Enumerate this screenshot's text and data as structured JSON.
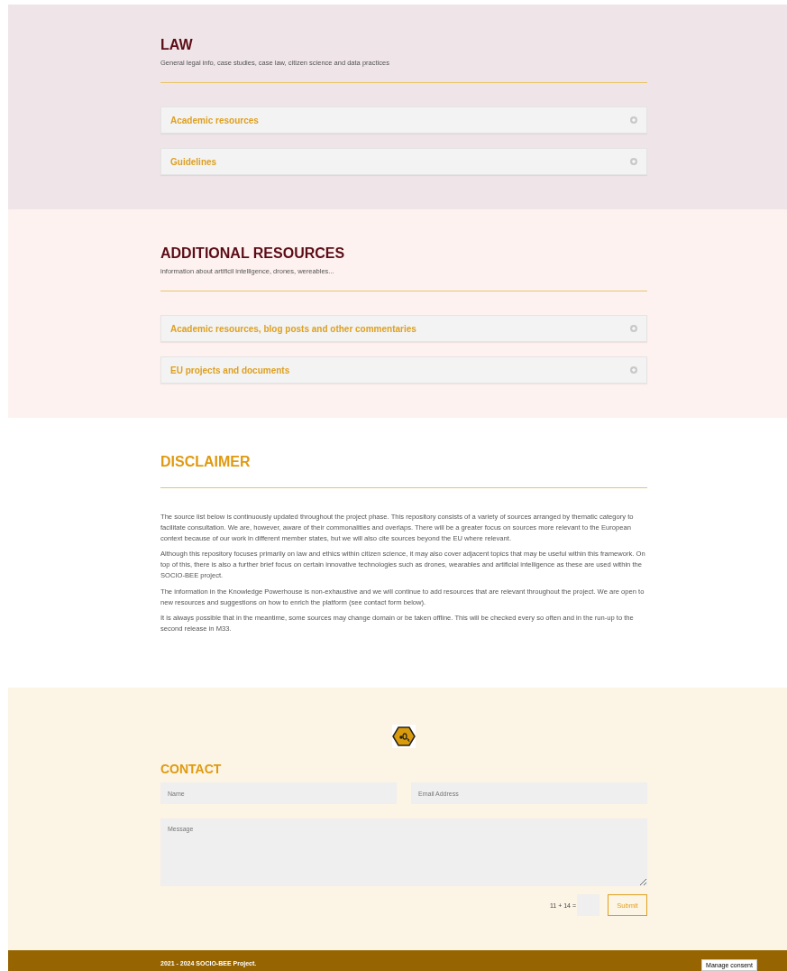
{
  "sections": [
    {
      "kind": "accordions",
      "color": "#efe5e8",
      "title": "LAW",
      "subtitle": "General legal info, case studies, case law, citizen science and data practices",
      "items": [
        {
          "label": "Academic resources",
          "expanded": false
        },
        {
          "label": "Guidelines",
          "expanded": false
        }
      ]
    },
    {
      "kind": "accordions",
      "color": "#fdf2ef",
      "title": "ADDITIONAL RESOURCES",
      "subtitle": "information about artificil intelligence, drones, wereables...",
      "items": [
        {
          "label": "Academic resources, blog posts and other commentaries",
          "expanded": false
        },
        {
          "label": "EU projects and documents",
          "expanded": false
        }
      ]
    },
    {
      "kind": "text",
      "color": "#ffffff",
      "title": "DISCLAIMER",
      "paragraphs": [
        "The source list below is continuously updated throughout the project phase. This repository consists of a variety of sources arranged by thematic category to facilitate consultation. We are, however, aware of their commonalities and overlaps. There will be a greater focus on sources more relevant to the European context because of our work in different member states, but we will also cite sources beyond the EU where relevant.",
        "Although this repository focuses primarily on law and ethics within citizen science, it may also cover adjacent topics that may be useful within this framework. On top of this, there is also a further brief focus on certain innovative technologies such as drones, wearables and artificial intelligence as these are used within the SOCIO-BEE project.",
        "The information in the Knowledge Powerhouse is non-exhaustive and we will continue to add resources that are relevant throughout the project. We are open to new resources and suggestions on how to enrich the platform (see contact form below).",
        "It is always possible that in the meantime, some sources may change domain or be taken offline. This will be checked every so often and in the run-up to the second release in M33."
      ]
    },
    {
      "kind": "contact",
      "color": "#fcf4e4",
      "title": "CONTACT",
      "name_placeholder": "Name",
      "email_placeholder": "Email Address",
      "message_placeholder": "Message",
      "captcha": "11 + 14 =",
      "submit": "Submit"
    }
  ],
  "footer": {
    "text": "2021 - 2024 SOCIO-BEE Project.",
    "consent_button": "Manage consent"
  }
}
